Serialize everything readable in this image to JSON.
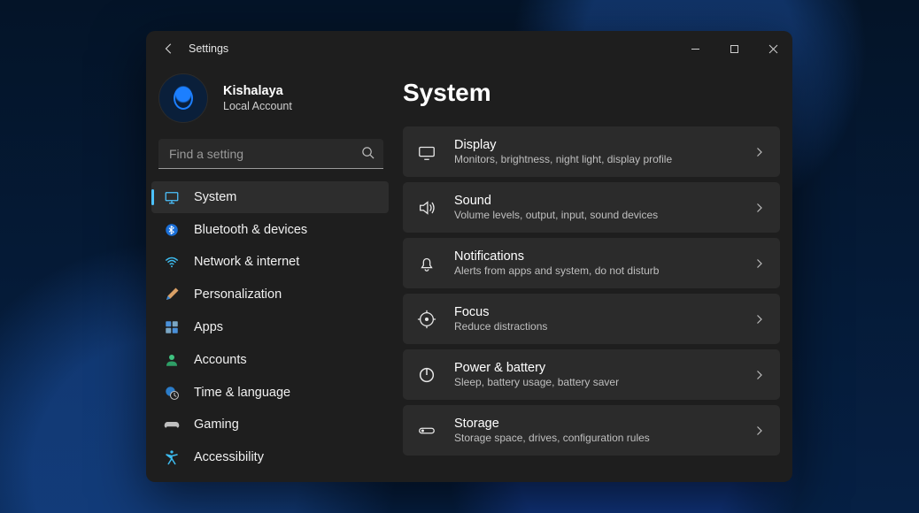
{
  "window": {
    "app_title": "Settings"
  },
  "profile": {
    "name": "Kishalaya",
    "sub": "Local Account"
  },
  "search": {
    "placeholder": "Find a setting"
  },
  "nav": {
    "items": [
      {
        "label": "System",
        "icon": "system-icon",
        "active": true
      },
      {
        "label": "Bluetooth & devices",
        "icon": "bluetooth-icon",
        "active": false
      },
      {
        "label": "Network & internet",
        "icon": "wifi-icon",
        "active": false
      },
      {
        "label": "Personalization",
        "icon": "paintbrush-icon",
        "active": false
      },
      {
        "label": "Apps",
        "icon": "apps-icon",
        "active": false
      },
      {
        "label": "Accounts",
        "icon": "person-icon",
        "active": false
      },
      {
        "label": "Time & language",
        "icon": "clock-globe-icon",
        "active": false
      },
      {
        "label": "Gaming",
        "icon": "gamepad-icon",
        "active": false
      },
      {
        "label": "Accessibility",
        "icon": "accessibility-icon",
        "active": false
      }
    ]
  },
  "main": {
    "title": "System",
    "items": [
      {
        "title": "Display",
        "sub": "Monitors, brightness, night light, display profile",
        "icon": "display-icon"
      },
      {
        "title": "Sound",
        "sub": "Volume levels, output, input, sound devices",
        "icon": "sound-icon"
      },
      {
        "title": "Notifications",
        "sub": "Alerts from apps and system, do not disturb",
        "icon": "bell-icon"
      },
      {
        "title": "Focus",
        "sub": "Reduce distractions",
        "icon": "focus-icon"
      },
      {
        "title": "Power & battery",
        "sub": "Sleep, battery usage, battery saver",
        "icon": "power-icon"
      },
      {
        "title": "Storage",
        "sub": "Storage space, drives, configuration rules",
        "icon": "storage-icon"
      }
    ]
  }
}
